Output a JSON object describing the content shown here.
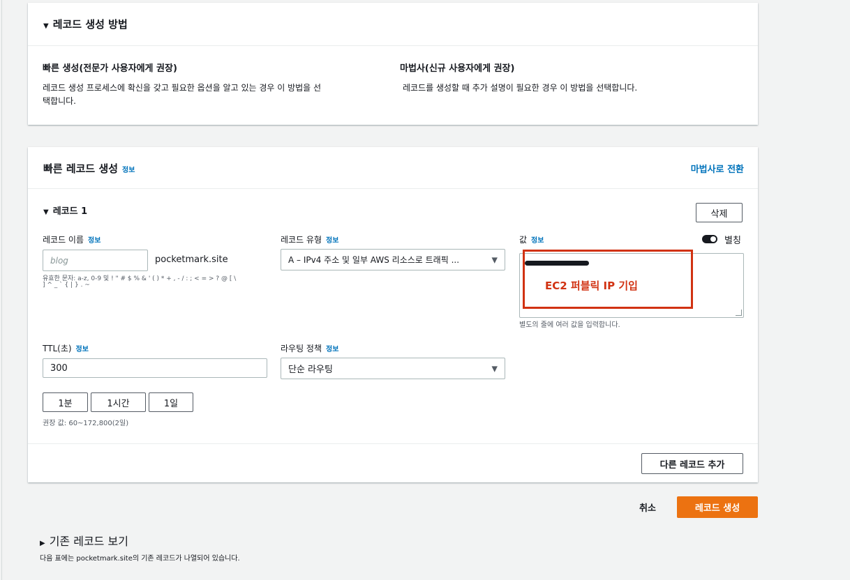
{
  "creation_method": {
    "title": "레코드 생성 방법",
    "quick": {
      "title": "빠른 생성(전문가 사용자에게 권장)",
      "desc_line1": "레코드 생성 프로세스에 확신을 갖고 필요한 옵션을 알고 있는 경우 이 방법을 선",
      "desc_line2": "택합니다."
    },
    "wizard": {
      "title": "마법사(신규 사용자에게 권장)",
      "desc": "레코드를 생성할 때 추가 설명이 필요한 경우 이 방법을 선택합니다."
    }
  },
  "quick_create": {
    "title": "빠른 레코드 생성",
    "info": "정보",
    "switch_wizard": "마법사로 전환",
    "record": {
      "title": "레코드 1",
      "delete_label": "삭제",
      "name": {
        "label": "레코드 이름",
        "info": "정보",
        "placeholder": "blog",
        "domain_suffix": "pocketmark.site",
        "hint_line1": "유효한 문자: a-z, 0-9 및 ! \" # $ % & ' ( ) * + , - / : ; < = > ? @ [ \\",
        "hint_line2": "] ^ _ ` { | } . ~"
      },
      "type": {
        "label": "레코드 유형",
        "info": "정보",
        "value": "A – IPv4 주소 및 일부 AWS 리소스로 트래픽 ...",
        "arrow": "▼"
      },
      "value": {
        "label": "값",
        "info": "정보",
        "alias_label": "별칭",
        "hint": "별도의 줄에 여러 값을 입력합니다.",
        "annotation": "EC2 퍼블릭 IP 기입"
      },
      "ttl": {
        "label": "TTL(초)",
        "info": "정보",
        "value": "300",
        "presets": [
          "1분",
          "1시간",
          "1일"
        ],
        "hint": "권장 값: 60~172,800(2일)"
      },
      "routing": {
        "label": "라우팅 정책",
        "info": "정보",
        "value": "단순 라우팅",
        "arrow": "▼"
      }
    },
    "add_record": "다른 레코드 추가"
  },
  "actions": {
    "cancel": "취소",
    "create": "레코드 생성"
  },
  "existing": {
    "title": "기존 레코드 보기",
    "desc": "다음 표에는 pocketmark.site의 기존 레코드가 나열되어 있습니다."
  },
  "colors": {
    "accent": "#ec7211",
    "link": "#0073bb",
    "annotation": "#d13212"
  }
}
